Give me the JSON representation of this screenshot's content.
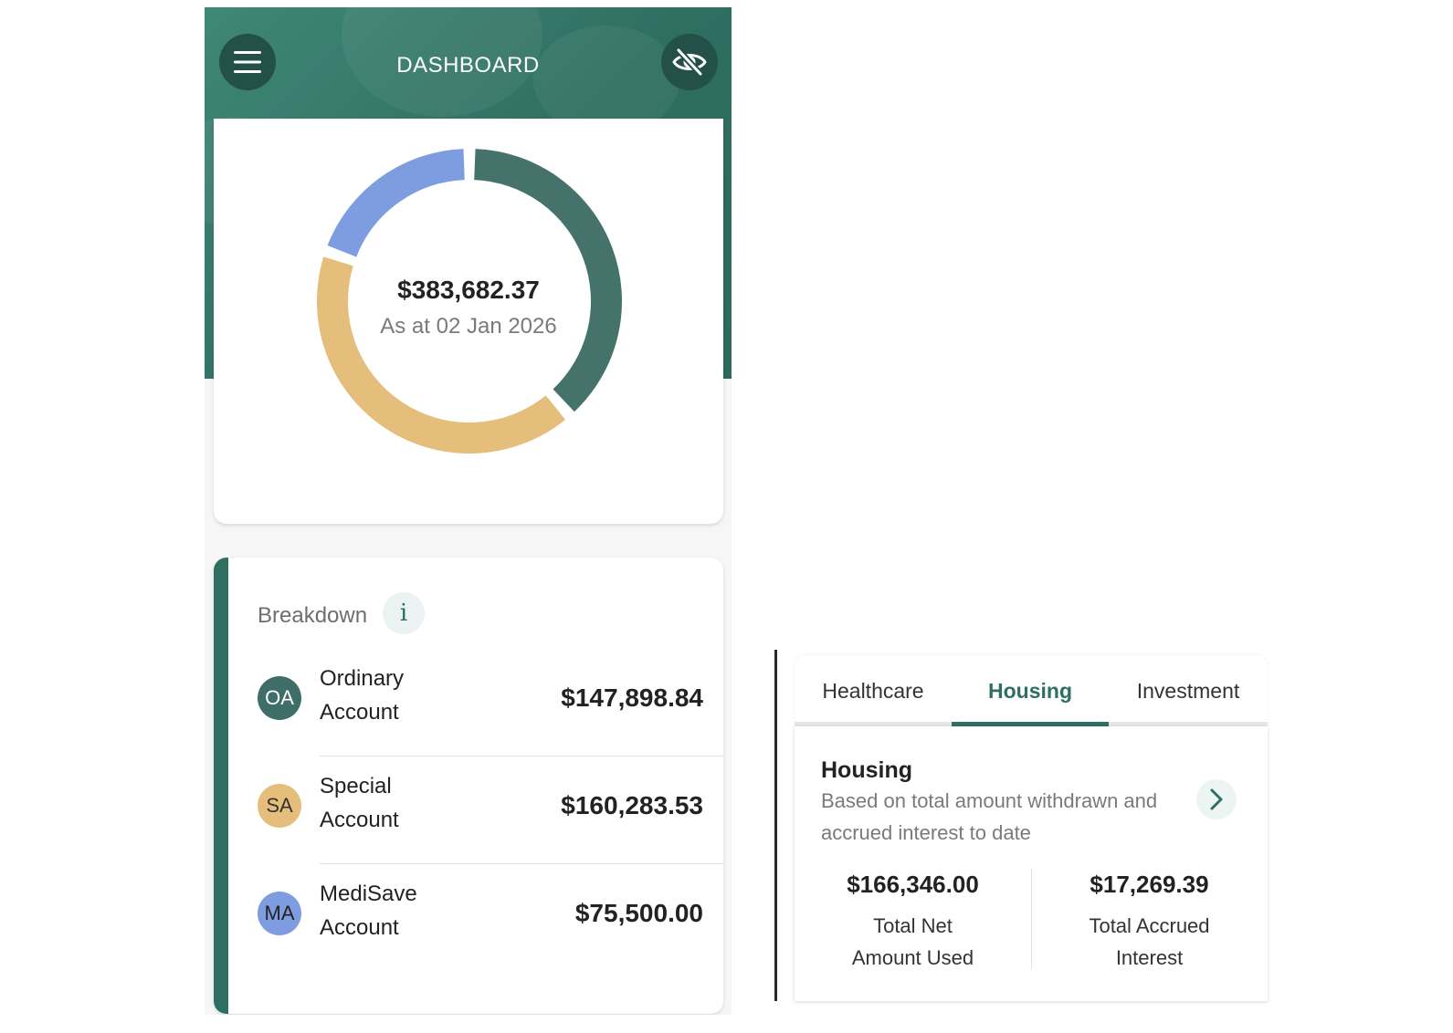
{
  "header": {
    "title": "DASHBOARD",
    "menu_icon": "hamburger-menu-icon",
    "hide_icon": "eye-off-icon",
    "background_color": "#2f6f62"
  },
  "summary": {
    "total": "$383,682.37",
    "as_at": "As at 02 Jan 2026"
  },
  "chart_data": {
    "type": "pie",
    "style": "donut",
    "categories": [
      "Ordinary Account",
      "Special Account",
      "MediSave Account"
    ],
    "values": [
      147898.84,
      160283.53,
      75500.0
    ],
    "colors": [
      "#45736c",
      "#e4be7a",
      "#7e9de0"
    ],
    "title": "",
    "center_label": "$383,682.37"
  },
  "breakdown": {
    "title": "Breakdown",
    "info_icon": "i",
    "accounts": [
      {
        "badge": "OA",
        "line1": "Ordinary",
        "line2": "Account",
        "amount": "$147,898.84",
        "badge_color": "#3f6d67",
        "badge_text_color": "#ffffff"
      },
      {
        "badge": "SA",
        "line1": "Special",
        "line2": "Account",
        "amount": "$160,283.53",
        "badge_color": "#e4be7a",
        "badge_text_color": "#333333"
      },
      {
        "badge": "MA",
        "line1": "MediSave",
        "line2": "Account",
        "amount": "$75,500.00",
        "badge_color": "#7e9de0",
        "badge_text_color": "#222222"
      }
    ]
  },
  "tabs": {
    "items": [
      "Healthcare",
      "Housing",
      "Investment"
    ],
    "active": "Housing",
    "accent_color": "#2f6f62"
  },
  "housing": {
    "title": "Housing",
    "description": "Based on total amount withdrawn and accrued interest to date",
    "arrow_icon": "chevron-right-icon",
    "stats": [
      {
        "value": "$166,346.00",
        "label_line1": "Total Net",
        "label_line2": "Amount Used"
      },
      {
        "value": "$17,269.39",
        "label_line1": "Total Accrued",
        "label_line2": "Interest"
      }
    ]
  }
}
